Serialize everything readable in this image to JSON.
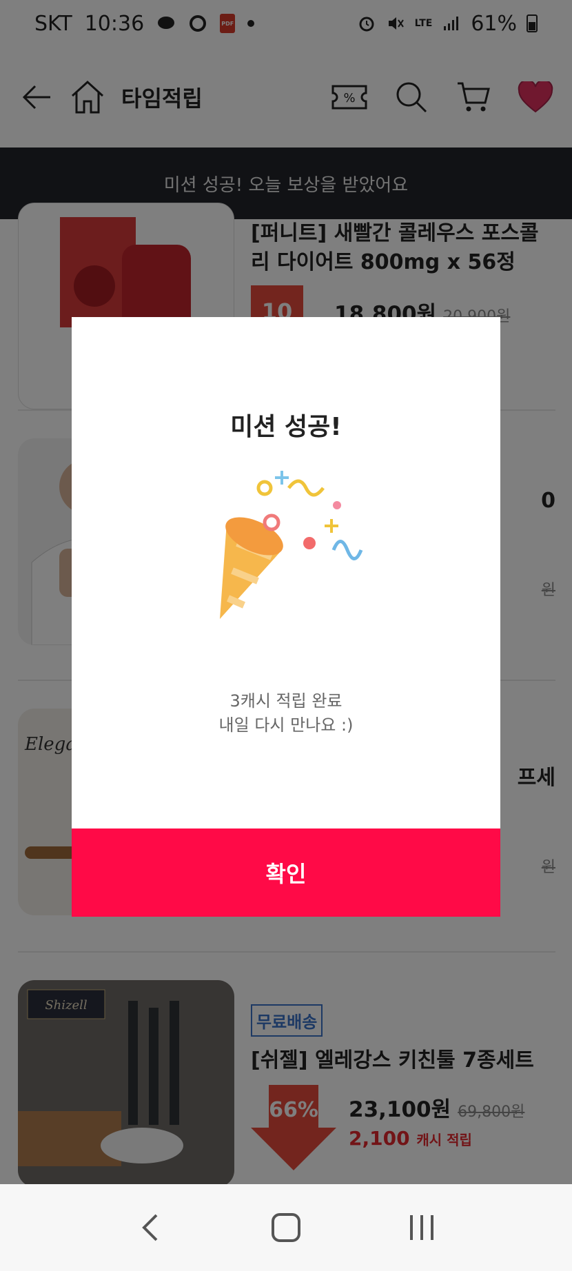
{
  "status_bar": {
    "carrier": "SKT",
    "time": "10:36",
    "network": "LTE",
    "battery": "61%"
  },
  "header": {
    "title": "타임적립",
    "icons": [
      "back-arrow-icon",
      "home-icon",
      "coupon-icon",
      "search-icon",
      "cart-icon",
      "heart-icon"
    ]
  },
  "toast": {
    "message": "미션 성공! 오늘 보상을 받았어요"
  },
  "products": [
    {
      "name": "[퍼니트] 새빨간 콜레우스 포스콜리 다이어트 800mg x 56정",
      "discount": "10",
      "price": "18,800원",
      "original_price": "20,900원"
    },
    {
      "name_fragment": "0",
      "original_price_fragment": "원"
    },
    {
      "name_fragment": "프세",
      "original_price_fragment": "원"
    },
    {
      "badge": "무료배송",
      "name": "[쉬젤] 엘레강스 키친툴 7종세트",
      "discount": "66%",
      "price": "23,100원",
      "original_price": "69,800원",
      "cash_amount": "2,100",
      "cash_label": "캐시 적립"
    }
  ],
  "modal": {
    "title": "미션 성공!",
    "message_line1": "3캐시 적립 완료",
    "message_line2": "내일 다시 만나요 :)",
    "confirm_label": "확인"
  },
  "colors": {
    "accent": "#ff0a47",
    "toast_bg": "#22252b",
    "discount_red": "#e74b3c",
    "free_shipping_blue": "#3a73c9"
  }
}
